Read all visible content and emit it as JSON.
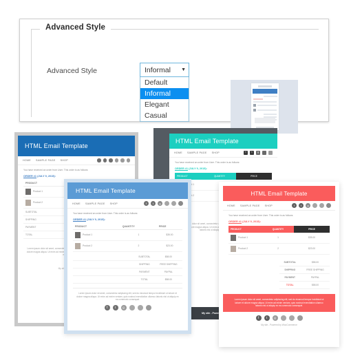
{
  "panel": {
    "legend": "Advanced Style",
    "field_label": "Advanced Style",
    "select": {
      "value": "Informal",
      "caret": "▼",
      "options": [
        "Default",
        "Informal",
        "Elegant",
        "Casual"
      ],
      "selected_index": 1
    }
  },
  "email": {
    "title": "HTML Email Template",
    "nav": [
      "HOME",
      "SAMPLE PAGE",
      "SHOP"
    ],
    "social_icons": [
      "facebook-icon",
      "twitter-icon",
      "google-plus-icon",
      "linkedin-icon",
      "pinterest-icon",
      "rss-icon"
    ],
    "social_glyphs": [
      "f",
      "t",
      "g",
      "in",
      "p",
      "»"
    ],
    "intro": "You have received an order from User. This order is as follows:",
    "order_label": "ORDER #1",
    "order_date": "(JULY 9, 2015):",
    "columns": [
      "PRODUCT",
      "QUANTITY",
      "PRICE"
    ],
    "rows": [
      {
        "product": "Product 1",
        "quantity": "1",
        "price": "$35.00"
      },
      {
        "product": "Product 2",
        "quantity": "2",
        "price": "$23.00"
      }
    ],
    "totals": [
      {
        "label": "SUBTOTAL",
        "value": "$58.00"
      },
      {
        "label": "SHIPPING",
        "value": "FREE SHIPPING"
      },
      {
        "label": "PAYMENT",
        "value": "PAYPAL"
      },
      {
        "label": "TOTAL",
        "value": "$58.00"
      }
    ],
    "footer_text": "Lorem ipsum dolor sit amet, consectetur adipiscing elit, sed do eiusmod tempor incididunt ut labore et dolore magna aliqua. Ut enim ad minim veniam, quis nostrud exercitation ullamco laboris nisi ut aliquip ex ea commodo consequat.",
    "powered": "My site - Powered by WooCommerce"
  },
  "cards": [
    {
      "name": "blue-classic-template-card",
      "accent": "#1a6db5",
      "frame": "#c9c9c9",
      "nav_bg": "#ffffff",
      "header_text_align": "left"
    },
    {
      "name": "teal-dark-template-card",
      "accent": "#1ccfc0",
      "frame": "#545b62",
      "nav_bg": "#ffffff",
      "header_text_align": "left"
    },
    {
      "name": "blue-informal-template-card",
      "accent": "#5b9bd5",
      "frame": "#cfe0f0",
      "nav_bg": "#ffffff",
      "header_text_align": "left"
    },
    {
      "name": "red-casual-template-card",
      "accent": "#fa5c5c",
      "frame": "#ffffff",
      "nav_bg": "#ffffff",
      "header_text_align": "center"
    }
  ],
  "colors": {
    "select_highlight": "#0c8ff0",
    "select_border": "#6fb7dd",
    "panel_border": "#cfcfcf",
    "link_blue": "#3f7fc4",
    "dark_header": "#2f2f2f"
  }
}
